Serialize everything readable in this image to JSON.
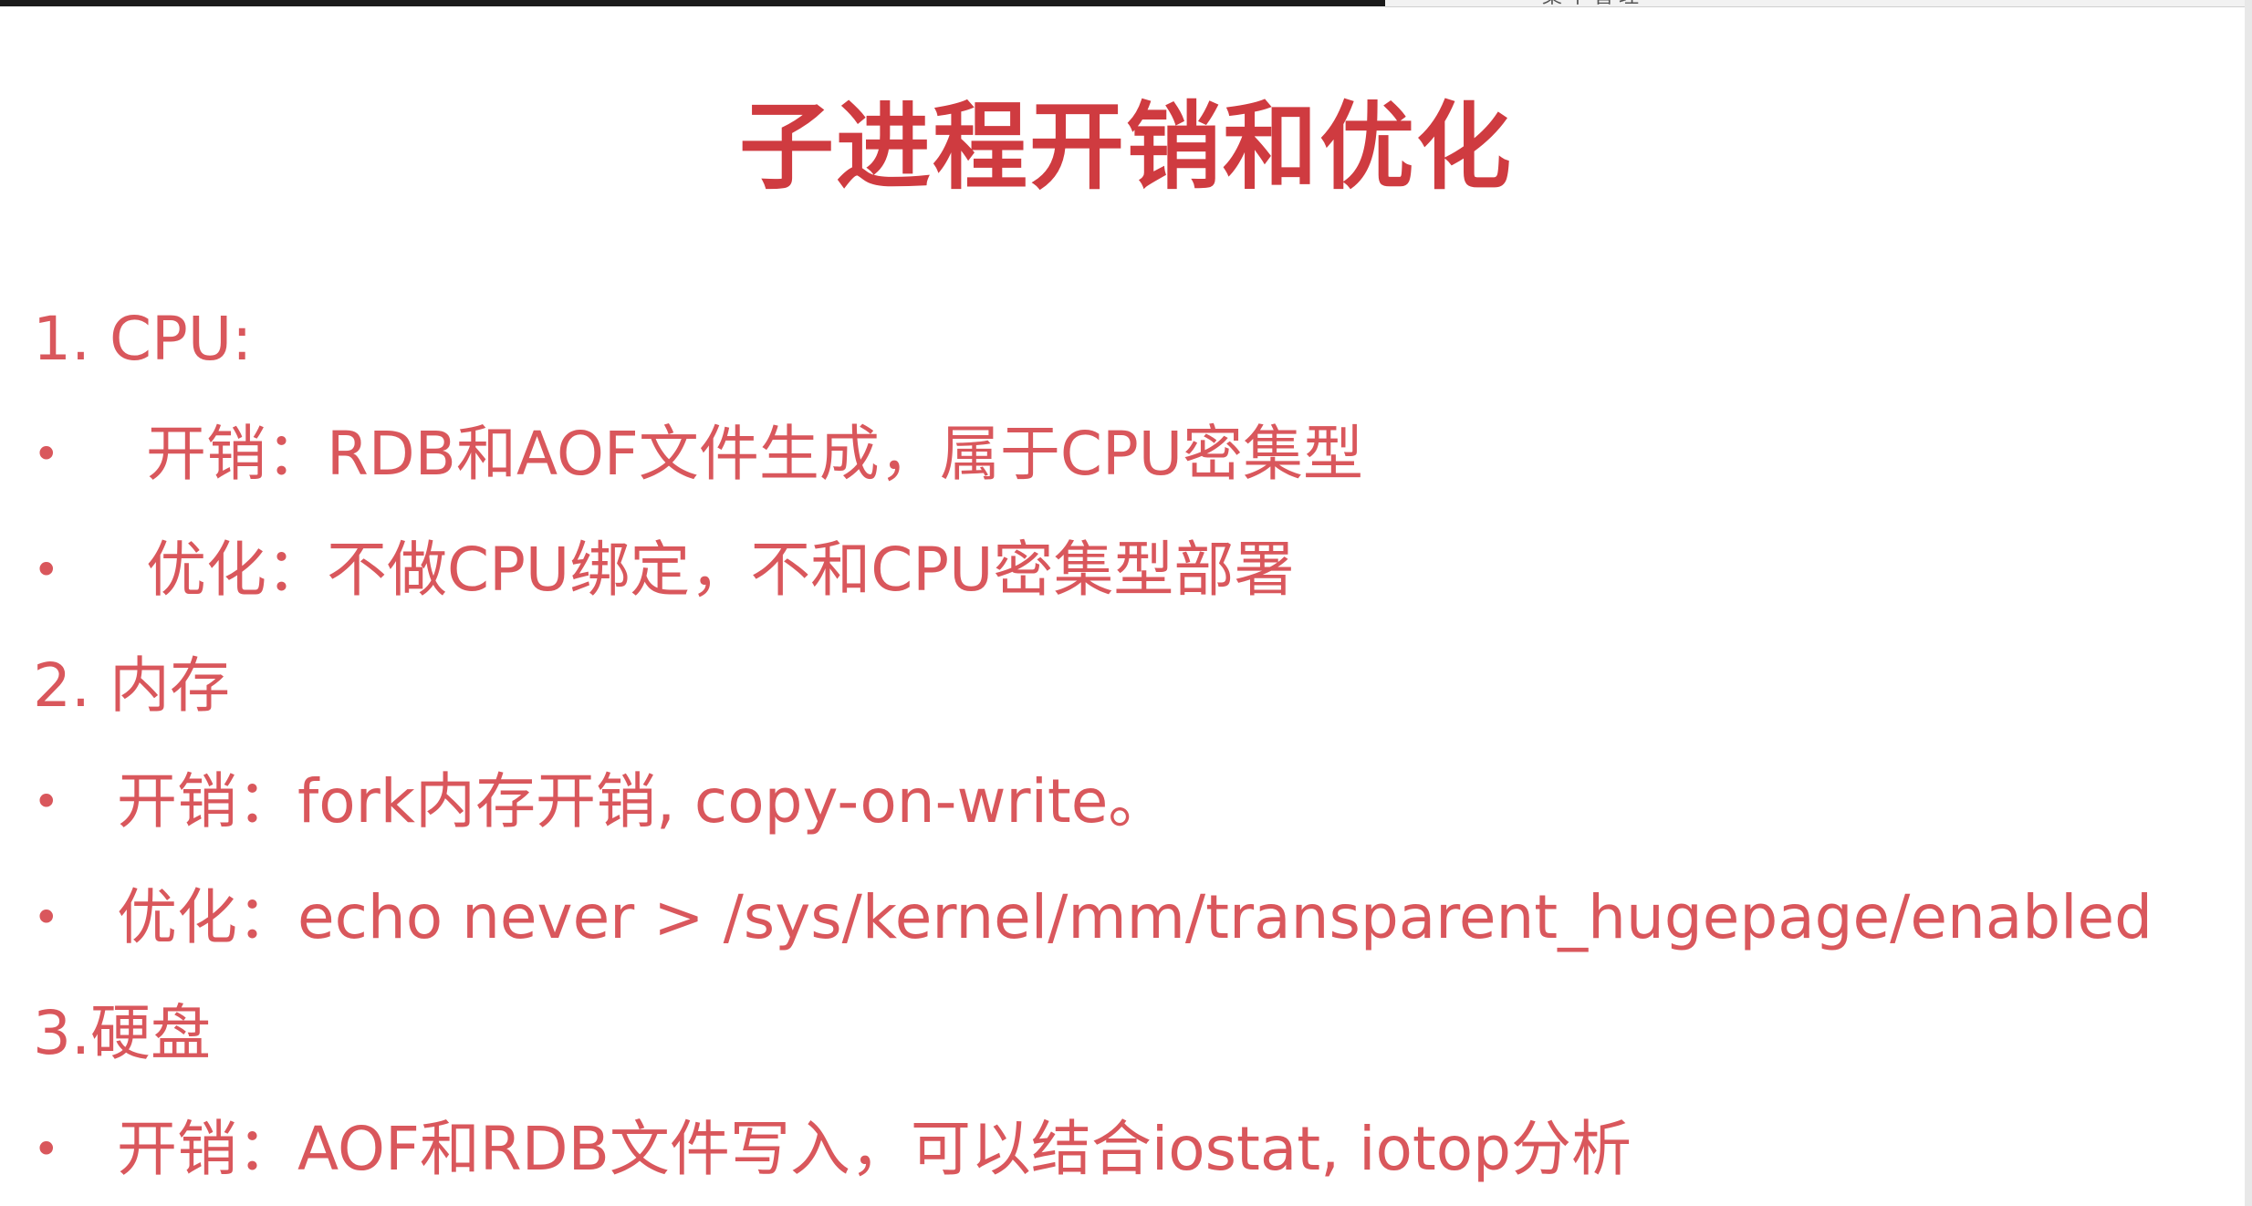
{
  "slide": {
    "title": "子进程开销和优化",
    "top_snippet": "集中管理",
    "sections": [
      {
        "heading": "1. CPU:",
        "items": [
          {
            "bullet": "•",
            "text": "开销：RDB和AOF文件生成，属于CPU密集型"
          },
          {
            "bullet": "•",
            "text": "优化：不做CPU绑定，不和CPU密集型部署"
          }
        ]
      },
      {
        "heading": "2. 内存",
        "items": [
          {
            "bullet": "•",
            "text": "开销：fork内存开销, copy-on-write。"
          },
          {
            "bullet": "•",
            "text": "优化：echo never > /sys/kernel/mm/transparent_hugepage/enabled"
          }
        ]
      },
      {
        "heading": "3.硬盘",
        "items": [
          {
            "bullet": "•",
            "text": "开销：AOF和RDB文件写入，可以结合iostat, iotop分析"
          }
        ]
      }
    ]
  },
  "colors": {
    "title": "#cf3b40",
    "text": "#d9575c",
    "background": "#ffffff"
  }
}
